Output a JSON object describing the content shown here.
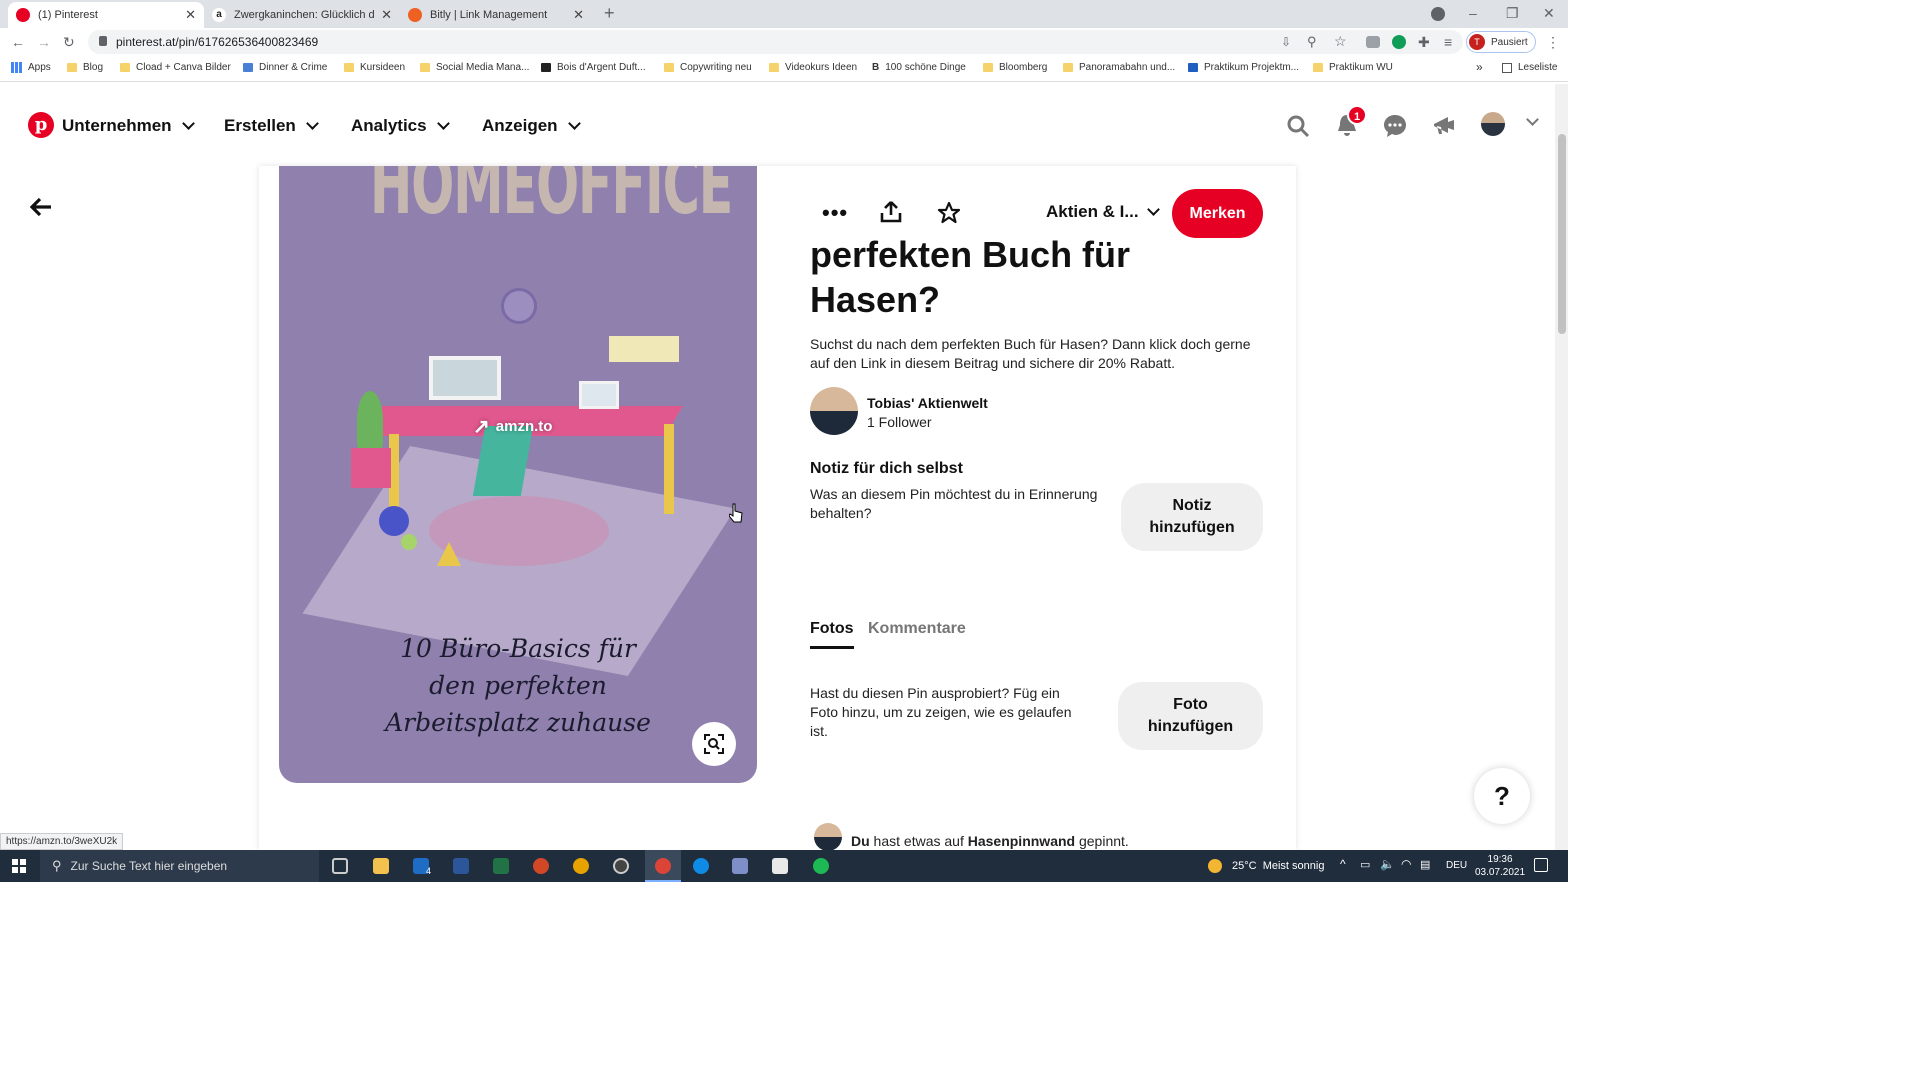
{
  "browser": {
    "tabs": [
      {
        "title": "(1) Pinterest",
        "color": "#e60023"
      },
      {
        "title": "Zwergkaninchen: Glücklich durch",
        "color": "#222222"
      },
      {
        "title": "Bitly | Link Management",
        "color": "#ee6123"
      }
    ],
    "url": "pinterest.at/pin/617626536400823469",
    "profile_label": "Pausiert",
    "profile_initial": "T",
    "bookmarks": [
      "Apps",
      "Blog",
      "Cload + Canva Bilder",
      "Dinner & Crime",
      "Kursideen",
      "Social Media Mana...",
      "Bois d'Argent Duft...",
      "Copywriting neu",
      "Videokurs Ideen",
      "100 schöne Dinge",
      "Bloomberg",
      "Panoramabahn und...",
      "Praktikum Projektm...",
      "Praktikum WU"
    ],
    "reading_list": "Leseliste",
    "bookmark_overflow": "»",
    "status_url": "https://amzn.to/3weXU2k"
  },
  "header": {
    "nav": [
      "Unternehmen",
      "Erstellen",
      "Analytics",
      "Anzeigen"
    ],
    "notification_count": "1"
  },
  "pin": {
    "image_title": "HOMEOFFICE",
    "image_subtitle": [
      "10 Büro-Basics für",
      "den perfekten",
      "Arbeitsplatz zuhause"
    ],
    "link_domain": "amzn.to",
    "board": "Aktien & I...",
    "save_label": "Merken",
    "title_lines": [
      "perfekten Buch für",
      "Hasen?"
    ],
    "description": "Suchst du nach dem perfekten Buch für Hasen? Dann klick doch gerne auf den Link in diesem Beitrag und sichere dir 20% Rabatt.",
    "author": {
      "name": "Tobias' Aktienwelt",
      "followers": "1 Follower"
    },
    "note": {
      "heading": "Notiz für dich selbst",
      "text": "Was an diesem Pin möchtest du in Erinnerung behalten?",
      "button": "Notiz hinzufügen"
    },
    "tabs": [
      "Fotos",
      "Kommentare"
    ],
    "photo": {
      "text": "Hast du diesen Pin ausprobiert? Füg ein Foto hinzu, um zu zeigen, wie es gelaufen ist.",
      "button": "Foto hinzufügen"
    },
    "activity": {
      "who": "Du",
      "mid": " hast etwas auf ",
      "board": "Hasenpinnwand",
      "end": " gepinnt."
    }
  },
  "help_label": "?",
  "taskbar": {
    "search_placeholder": "Zur Suche Text hier eingeben",
    "weather": "25°C  Meist sonnig",
    "lang": "DEU",
    "time": "19:36",
    "date": "03.07.2021",
    "mail_badge": "4"
  },
  "colors": {
    "pinterest_red": "#e60023",
    "pin_bg": "#8f80ad"
  }
}
